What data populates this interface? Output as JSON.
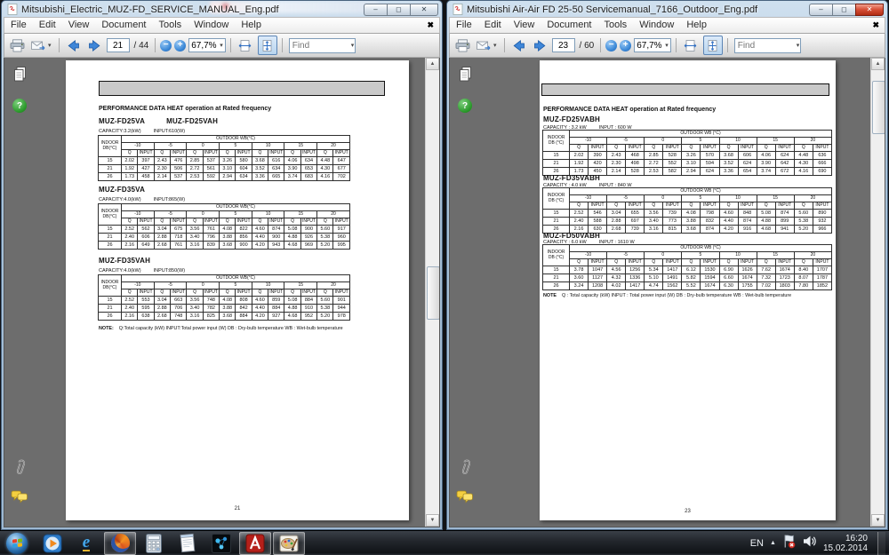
{
  "windows": [
    {
      "title": "Mitsubishi_Electric_MUZ-FD_SERVICE_MANUAL_Eng.pdf",
      "active": false,
      "menu": [
        "File",
        "Edit",
        "View",
        "Document",
        "Tools",
        "Window",
        "Help"
      ],
      "toolbar": {
        "page_value": "21",
        "page_total": "/ 44",
        "zoom_value": "67,7%",
        "find_placeholder": "Find"
      },
      "nav_icons": [
        "pages-icon",
        "howto-help-icon",
        "attachments-icon",
        "comments-icon"
      ],
      "document": {
        "heading": "PERFORMANCE DATA  HEAT operation at Rated frequency",
        "table_header": {
          "outdoor": "OUTDOOR   WB(°C)",
          "indoor_line1": "INDOOR",
          "indoor_line2": "DB(°C)",
          "temps": [
            "-10",
            "-5",
            "0",
            "5",
            "10",
            "15",
            "20"
          ],
          "sub": [
            "Q",
            "INPUT"
          ]
        },
        "sections": [
          {
            "models": [
              "MUZ-FD25VA",
              "MUZ-FD25VAH"
            ],
            "capacity": "CAPACITY:3.2(kW)",
            "input": "INPUT:610(W)",
            "rows": [
              {
                "db": "15",
                "v": [
                  "2.02",
                  "397",
                  "2.43",
                  "476",
                  "2.85",
                  "537",
                  "3.26",
                  "580",
                  "3.68",
                  "616",
                  "4.06",
                  "634",
                  "4.48",
                  "647"
                ]
              },
              {
                "db": "21",
                "v": [
                  "1.92",
                  "427",
                  "2.30",
                  "506",
                  "2.72",
                  "561",
                  "3.10",
                  "604",
                  "3.52",
                  "634",
                  "3.90",
                  "653",
                  "4.30",
                  "677"
                ]
              },
              {
                "db": "26",
                "v": [
                  "1.73",
                  "458",
                  "2.14",
                  "537",
                  "2.53",
                  "592",
                  "2.94",
                  "634",
                  "3.36",
                  "665",
                  "3.74",
                  "683",
                  "4.16",
                  "702"
                ]
              }
            ]
          },
          {
            "models": [
              "MUZ-FD35VA"
            ],
            "capacity": "CAPACITY:4.0(kW)",
            "input": "INPUT:865(W)",
            "rows": [
              {
                "db": "15",
                "v": [
                  "2.52",
                  "562",
                  "3.04",
                  "675",
                  "3.56",
                  "761",
                  "4.08",
                  "822",
                  "4.60",
                  "874",
                  "5.08",
                  "900",
                  "5.60",
                  "917"
                ]
              },
              {
                "db": "21",
                "v": [
                  "2.40",
                  "606",
                  "2.88",
                  "718",
                  "3.40",
                  "796",
                  "3.88",
                  "856",
                  "4.40",
                  "900",
                  "4.88",
                  "926",
                  "5.38",
                  "960"
                ]
              },
              {
                "db": "26",
                "v": [
                  "2.16",
                  "649",
                  "2.68",
                  "761",
                  "3.16",
                  "839",
                  "3.68",
                  "900",
                  "4.20",
                  "943",
                  "4.68",
                  "969",
                  "5.20",
                  "995"
                ]
              }
            ]
          },
          {
            "models": [
              "MUZ-FD35VAH"
            ],
            "capacity": "CAPACITY:4.0(kW)",
            "input": "INPUT:850(W)",
            "rows": [
              {
                "db": "15",
                "v": [
                  "2.52",
                  "553",
                  "3.04",
                  "663",
                  "3.56",
                  "748",
                  "4.08",
                  "808",
                  "4.60",
                  "859",
                  "5.08",
                  "884",
                  "5.60",
                  "901"
                ]
              },
              {
                "db": "21",
                "v": [
                  "2.40",
                  "595",
                  "2.88",
                  "706",
                  "3.40",
                  "782",
                  "3.88",
                  "842",
                  "4.40",
                  "884",
                  "4.88",
                  "910",
                  "5.38",
                  "944"
                ]
              },
              {
                "db": "26",
                "v": [
                  "2.16",
                  "638",
                  "2.68",
                  "748",
                  "3.16",
                  "825",
                  "3.68",
                  "884",
                  "4.20",
                  "927",
                  "4.68",
                  "952",
                  "5.20",
                  "978"
                ]
              }
            ]
          }
        ],
        "note_label": "NOTE:",
        "note": "Q:Total capacity (kW)   INPUT:Total power input (W)   DB : Dry-bulb temperature   WB : Wet-bulb temperature",
        "page_number": "21"
      }
    },
    {
      "title": "Mitsubishi Air-Air FD 25-50 Servicemanual_7166_Outdoor_Eng.pdf",
      "active": true,
      "menu": [
        "File",
        "Edit",
        "View",
        "Document",
        "Tools",
        "Window",
        "Help"
      ],
      "toolbar": {
        "page_value": "23",
        "page_total": "/ 60",
        "zoom_value": "67,7%",
        "find_placeholder": "Find"
      },
      "nav_icons": [
        "pages-icon",
        "howto-help-icon",
        "attachments-icon",
        "comments-icon"
      ],
      "document": {
        "heading": "PERFORMANCE DATA  HEAT operation at Rated frequency",
        "table_header": {
          "outdoor": "OUTDOOR WB (°C)",
          "indoor_line1": "INDOOR",
          "indoor_line2": "DB (°C)",
          "temps": [
            "-10",
            "-5",
            "0",
            "5",
            "10",
            "15",
            "20"
          ],
          "sub": [
            "Q",
            "INPUT"
          ]
        },
        "sections": [
          {
            "models": [
              "MUZ-FD25VABH"
            ],
            "capacity": "CAPACITY : 3.2 kW",
            "input": "INPUT : 600 W",
            "rows": [
              {
                "db": "15",
                "v": [
                  "2.02",
                  "390",
                  "2.43",
                  "468",
                  "2.85",
                  "528",
                  "3.26",
                  "570",
                  "3.68",
                  "606",
                  "4.06",
                  "624",
                  "4.48",
                  "636"
                ]
              },
              {
                "db": "21",
                "v": [
                  "1.92",
                  "420",
                  "2.30",
                  "498",
                  "2.72",
                  "552",
                  "3.10",
                  "594",
                  "3.52",
                  "624",
                  "3.90",
                  "642",
                  "4.30",
                  "666"
                ]
              },
              {
                "db": "26",
                "v": [
                  "1.73",
                  "450",
                  "2.14",
                  "528",
                  "2.53",
                  "582",
                  "2.94",
                  "624",
                  "3.36",
                  "654",
                  "3.74",
                  "672",
                  "4.16",
                  "690"
                ]
              }
            ]
          },
          {
            "models": [
              "MUZ-FD35VABH"
            ],
            "capacity": "CAPACITY : 4.0 kW",
            "input": "INPUT : 840 W",
            "rows": [
              {
                "db": "15",
                "v": [
                  "2.52",
                  "546",
                  "3.04",
                  "655",
                  "3.56",
                  "739",
                  "4.08",
                  "798",
                  "4.60",
                  "848",
                  "5.08",
                  "874",
                  "5.60",
                  "890"
                ]
              },
              {
                "db": "21",
                "v": [
                  "2.40",
                  "588",
                  "2.88",
                  "697",
                  "3.40",
                  "773",
                  "3.88",
                  "832",
                  "4.40",
                  "874",
                  "4.88",
                  "899",
                  "5.38",
                  "932"
                ]
              },
              {
                "db": "26",
                "v": [
                  "2.16",
                  "630",
                  "2.68",
                  "739",
                  "3.16",
                  "815",
                  "3.68",
                  "874",
                  "4.20",
                  "916",
                  "4.68",
                  "941",
                  "5.20",
                  "966"
                ]
              }
            ]
          },
          {
            "models": [
              "MUZ-FD50VABH"
            ],
            "capacity": "CAPACITY : 6.0 kW",
            "input": "INPUT : 1610 W",
            "rows": [
              {
                "db": "15",
                "v": [
                  "3.78",
                  "1047",
                  "4.56",
                  "1256",
                  "5.34",
                  "1417",
                  "6.12",
                  "1530",
                  "6.90",
                  "1626",
                  "7.62",
                  "1674",
                  "8.40",
                  "1707"
                ]
              },
              {
                "db": "21",
                "v": [
                  "3.60",
                  "1127",
                  "4.32",
                  "1336",
                  "5.10",
                  "1491",
                  "5.82",
                  "1594",
                  "6.60",
                  "1674",
                  "7.32",
                  "1723",
                  "8.07",
                  "1787"
                ]
              },
              {
                "db": "26",
                "v": [
                  "3.24",
                  "1208",
                  "4.02",
                  "1417",
                  "4.74",
                  "1562",
                  "5.52",
                  "1674",
                  "6.30",
                  "1755",
                  "7.02",
                  "1803",
                  "7.80",
                  "1852"
                ]
              }
            ]
          }
        ],
        "note_label": "NOTE",
        "note": "Q : Total capacity (kW)   INPUT : Total power input (W)   DB : Dry-bulb temperature   WB : Wet-bulb temperature",
        "page_number": "23"
      }
    }
  ],
  "taskbar": {
    "icons": [
      {
        "name": "start-button",
        "open": false
      },
      {
        "name": "windows-media-player-icon",
        "open": false
      },
      {
        "name": "internet-explorer-icon",
        "open": false
      },
      {
        "name": "firefox-icon",
        "open": true
      },
      {
        "name": "calculator-icon",
        "open": false
      },
      {
        "name": "notepad-icon",
        "open": false
      },
      {
        "name": "molecule-app-icon",
        "open": false
      },
      {
        "name": "adobe-reader-icon",
        "open": true
      },
      {
        "name": "paint-icon",
        "open": true
      }
    ],
    "tray": {
      "language": "EN",
      "time": "16:20",
      "date": "15.02.2014"
    }
  }
}
